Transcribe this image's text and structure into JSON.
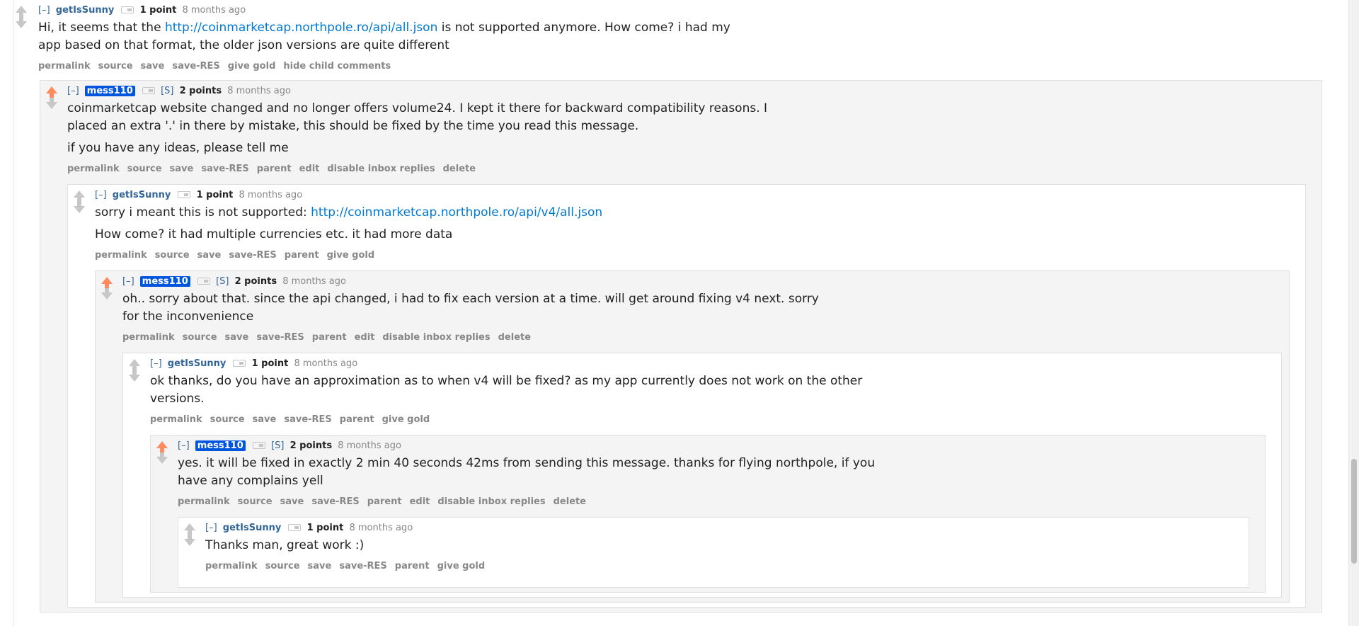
{
  "comments": {
    "c1": {
      "expand": "[–]",
      "author": "getIsSunny",
      "score": "1 point",
      "time": "8 months ago",
      "body": {
        "pre": "Hi, it seems that the ",
        "link": "http://coinmarketcap.northpole.ro/api/all.json",
        "post1": " is not supported anymore. How come? i had my",
        "post2": "app based on that format, the older json versions are quite different"
      },
      "buttons": [
        "permalink",
        "source",
        "save",
        "save-RES",
        "give gold",
        "hide child comments"
      ]
    },
    "c2": {
      "expand": "[–]",
      "author": "mess110",
      "submitter": "[S]",
      "score": "2 points",
      "time": "8 months ago",
      "body": {
        "line1": "coinmarketcap website changed and no longer offers volume24. I kept it there for backward compatibility reasons. I",
        "line2": "placed an extra '.' in there by mistake, this should be fixed by the time you read this message.",
        "para2": "if you have any ideas, please tell me"
      },
      "buttons": [
        "permalink",
        "source",
        "save",
        "save-RES",
        "parent",
        "edit",
        "disable inbox replies",
        "delete"
      ]
    },
    "c3": {
      "expand": "[–]",
      "author": "getIsSunny",
      "score": "1 point",
      "time": "8 months ago",
      "body": {
        "pre": "sorry i meant this is not supported: ",
        "link": "http://coinmarketcap.northpole.ro/api/v4/all.json",
        "para2": "How come? it had multiple currencies etc. it had more data"
      },
      "buttons": [
        "permalink",
        "source",
        "save",
        "save-RES",
        "parent",
        "give gold"
      ]
    },
    "c4": {
      "expand": "[–]",
      "author": "mess110",
      "submitter": "[S]",
      "score": "2 points",
      "time": "8 months ago",
      "body": {
        "line1": "oh.. sorry about that. since the api changed, i had to fix each version at a time. will get around fixing v4 next. sorry",
        "line2": "for the inconvenience"
      },
      "buttons": [
        "permalink",
        "source",
        "save",
        "save-RES",
        "parent",
        "edit",
        "disable inbox replies",
        "delete"
      ]
    },
    "c5": {
      "expand": "[–]",
      "author": "getIsSunny",
      "score": "1 point",
      "time": "8 months ago",
      "body": {
        "line1": "ok thanks, do you have an approximation as to when v4 will be fixed? as my app currently does not work on the other",
        "line2": "versions."
      },
      "buttons": [
        "permalink",
        "source",
        "save",
        "save-RES",
        "parent",
        "give gold"
      ]
    },
    "c6": {
      "expand": "[–]",
      "author": "mess110",
      "submitter": "[S]",
      "score": "2 points",
      "time": "8 months ago",
      "body": {
        "line1": "yes. it will be fixed in exactly 2 min 40 seconds 42ms from sending this message. thanks for flying northpole, if you",
        "line2": "have any complains yell"
      },
      "buttons": [
        "permalink",
        "source",
        "save",
        "save-RES",
        "parent",
        "edit",
        "disable inbox replies",
        "delete"
      ]
    },
    "c7": {
      "expand": "[–]",
      "author": "getIsSunny",
      "score": "1 point",
      "time": "8 months ago",
      "body": {
        "line1": "Thanks man, great work :)"
      },
      "buttons": [
        "permalink",
        "source",
        "save",
        "save-RES",
        "parent",
        "give gold"
      ]
    }
  },
  "colors": {
    "upvote": "#ff8b60",
    "arrow": "#c7c7c7",
    "link": "#0079d3",
    "submitter_bg": "#0055df",
    "author": "#336699"
  }
}
